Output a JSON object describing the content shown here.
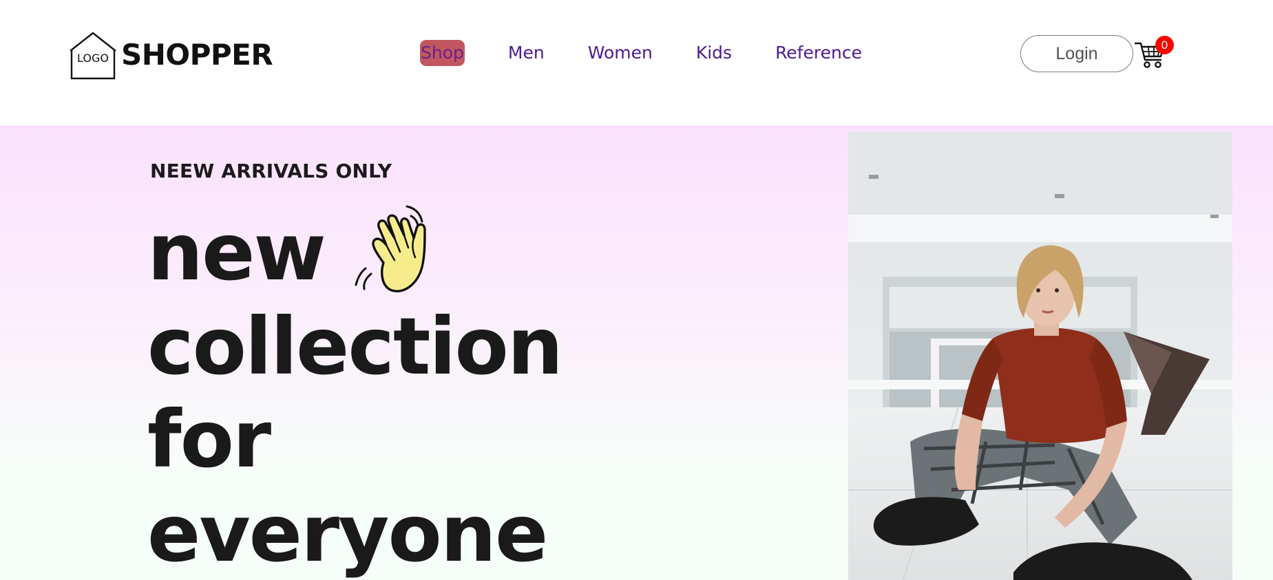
{
  "brand": {
    "logo_text": "LOGO",
    "name": "SHOPPER"
  },
  "nav": {
    "items": [
      {
        "label": "Shop",
        "active": true
      },
      {
        "label": "Men",
        "active": false
      },
      {
        "label": "Women",
        "active": false
      },
      {
        "label": "Kids",
        "active": false
      },
      {
        "label": "Reference",
        "active": false
      }
    ]
  },
  "header": {
    "login_label": "Login",
    "cart_count": "0"
  },
  "hero": {
    "tagline": "NEEW ARRIVALS ONLY",
    "headline": [
      "new",
      "collection",
      "for",
      "everyone"
    ],
    "hand_icon": "waving-hand-icon",
    "image": "hero-model-photo"
  },
  "colors": {
    "nav_text": "#4c1b8f",
    "nav_active_bg": "#c2575f",
    "cart_badge": "#ff0000",
    "hero_top": "#fbe1fe",
    "hero_bottom": "#f5fef9",
    "headline": "#1a1a1a"
  }
}
